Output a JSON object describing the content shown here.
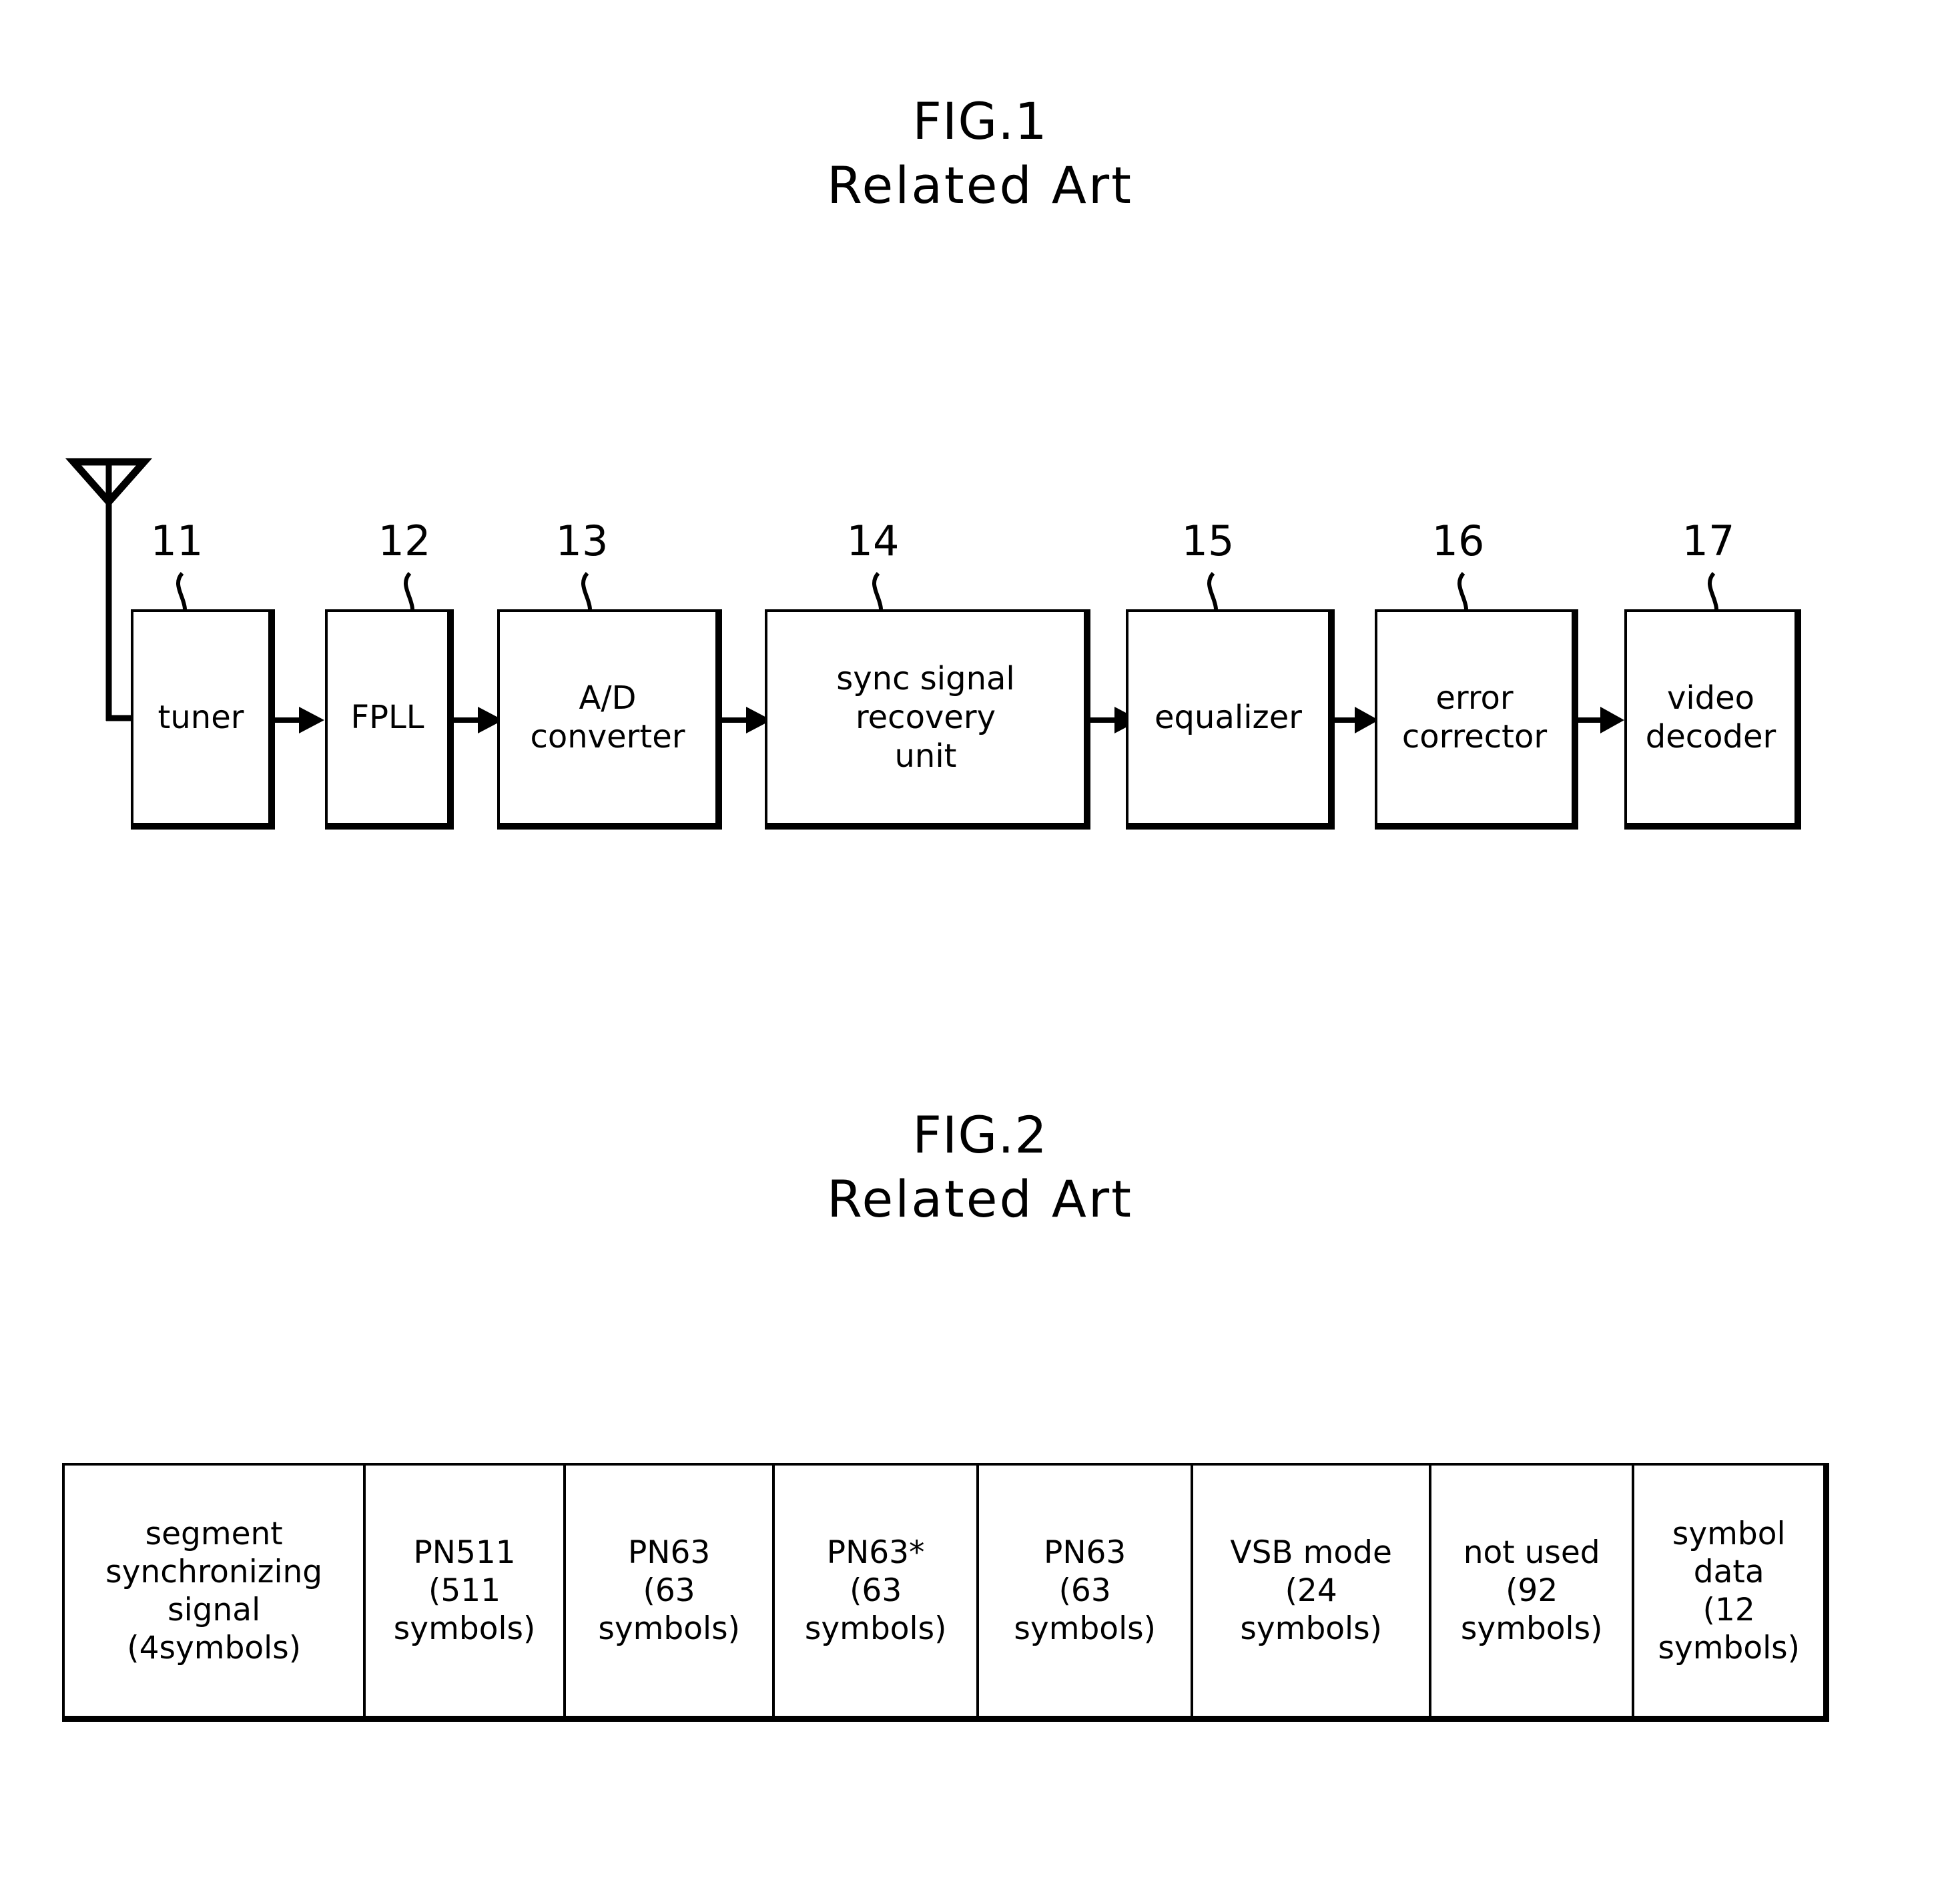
{
  "figures": [
    {
      "id": "fig1",
      "title_line1": "FIG.1",
      "title_line2": "Related  Art"
    },
    {
      "id": "fig2",
      "title_line1": "FIG.2",
      "title_line2": "Related  Art"
    }
  ],
  "fig1": {
    "title_line1": "FIG.1",
    "title_line2": "Related  Art",
    "antenna_icon": "antenna-dipole-icon",
    "blocks": [
      {
        "ref": "11",
        "label": "tuner"
      },
      {
        "ref": "12",
        "label": "FPLL"
      },
      {
        "ref": "13",
        "label": "A/D\nconverter"
      },
      {
        "ref": "14",
        "label": "sync  signal\nrecovery\nunit"
      },
      {
        "ref": "15",
        "label": "equalizer"
      },
      {
        "ref": "16",
        "label": "error\ncorrector"
      },
      {
        "ref": "17",
        "label": "video\ndecoder"
      }
    ]
  },
  "fig2": {
    "title_line1": "FIG.2",
    "title_line2": "Related  Art",
    "frame_cells": [
      {
        "name": "segment synchronizing signal",
        "text": "segment\nsynchronizing\nsignal\n(4symbols)"
      },
      {
        "name": "PN511",
        "text": "PN511\n(511\nsymbols)"
      },
      {
        "name": "PN63",
        "text": "PN63\n(63\nsymbols)"
      },
      {
        "name": "PN63*",
        "text": "PN63*\n(63\nsymbols)"
      },
      {
        "name": "PN63",
        "text": "PN63\n(63\nsymbols)"
      },
      {
        "name": "VSB mode",
        "text": "VSB  mode\n(24\nsymbols)"
      },
      {
        "name": "not used",
        "text": "not  used\n(92\nsymbols)"
      },
      {
        "name": "symbol data",
        "text": "symbol\ndata\n(12\nsymbols)"
      }
    ]
  },
  "colors": {
    "ink": "#000000",
    "paper": "#ffffff"
  }
}
